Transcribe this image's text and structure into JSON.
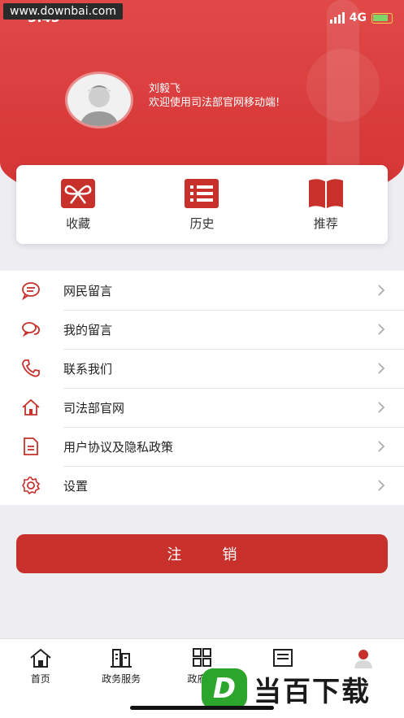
{
  "watermark": "www.downbai.com",
  "status": {
    "time": "3:45",
    "network": "4G"
  },
  "profile": {
    "name": "刘毅飞",
    "welcome": "欢迎使用司法部官网移动端!"
  },
  "quick_actions": [
    {
      "label": "收藏",
      "icon": "gift-icon"
    },
    {
      "label": "历史",
      "icon": "list-icon"
    },
    {
      "label": "推荐",
      "icon": "book-icon"
    }
  ],
  "menu": [
    {
      "label": "网民留言",
      "icon": "comment-icon"
    },
    {
      "label": "我的留言",
      "icon": "chat-bubbles-icon"
    },
    {
      "label": "联系我们",
      "icon": "phone-icon"
    },
    {
      "label": "司法部官网",
      "icon": "home-icon"
    },
    {
      "label": "用户协议及隐私政策",
      "icon": "document-icon"
    },
    {
      "label": "设置",
      "icon": "gear-icon"
    }
  ],
  "logout_label": "注销",
  "tabs": [
    {
      "label": "首页",
      "icon": "home-icon"
    },
    {
      "label": "政务服务",
      "icon": "building-icon"
    },
    {
      "label": "政府信",
      "icon": "grid-icon"
    },
    {
      "label": "",
      "icon": "news-icon"
    },
    {
      "label": "",
      "icon": "user-icon"
    }
  ],
  "brand": {
    "mark": "D",
    "text": "当百下载"
  },
  "colors": {
    "primary": "#c8312b",
    "header": "#d93b3b"
  }
}
